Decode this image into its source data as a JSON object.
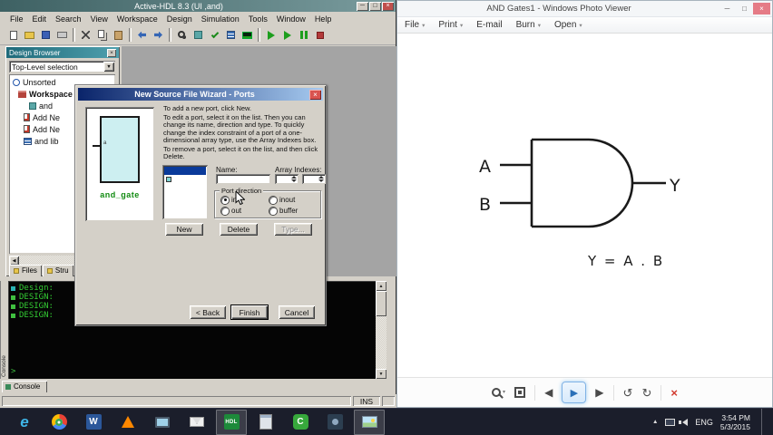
{
  "glyphs": {
    "minimize": "─",
    "maximize": "□",
    "close": "×",
    "up": "▲",
    "down": "▼",
    "left": "◀",
    "right": "▶",
    "play": "▶",
    "rotate_ccw": "↺",
    "rotate_cw": "↻",
    "delete_x": "×",
    "menu_arrow": "▾",
    "prompt": ">"
  },
  "hdl": {
    "title": "Active-HDL 8.3 (UI ,and)",
    "menus": [
      "File",
      "Edit",
      "Search",
      "View",
      "Workspace",
      "Design",
      "Simulation",
      "Tools",
      "Window",
      "Help"
    ],
    "toolbar_icons": [
      "new-file",
      "open",
      "save",
      "print",
      "cut",
      "copy",
      "paste",
      "undo",
      "redo",
      "find",
      "compile",
      "check",
      "library",
      "waveform",
      "run",
      "run-for",
      "pause",
      "stop"
    ],
    "browser": {
      "title": "Design Browser",
      "dropdown_value": "Top-Level selection",
      "tree": [
        "Unsorted",
        "Workspace",
        "and",
        "Add Ne",
        "Add Ne",
        "and lib"
      ],
      "tabs": [
        "Files",
        "Stru"
      ]
    },
    "console": {
      "side_label": "Console",
      "lines": [
        "Design:",
        "DESIGN:",
        "DESIGN:",
        "DESIGN:"
      ],
      "tab": "Console"
    },
    "status_ins": "INS"
  },
  "wizard": {
    "title": "New Source File Wizard - Ports",
    "intro": "To add a new port, click New.",
    "edit_help": "To edit a port, select it on the list. Then you can change its name, direction and type. To quickly change the index constraint of a port of a one-dimensional array type, use the Array Indexes box.",
    "remove_help": "To remove a port, select it on the list, and then click Delete.",
    "name_label": "Name:",
    "name_value": "",
    "array_label": "Array Indexes:",
    "group_label": "Port direction",
    "dir_in": "in",
    "dir_out": "out",
    "dir_inout": "inout",
    "dir_buffer": "buffer",
    "selected_direction": "in",
    "new_btn": "New",
    "delete_btn": "Delete",
    "type_btn": "Type...",
    "back_btn": "< Back",
    "finish_btn": "Finish",
    "cancel_btn": "Cancel",
    "symbol_label": "and_gate",
    "port_name": "a"
  },
  "viewer": {
    "title": "AND Gates1 - Windows Photo Viewer",
    "menus": [
      "File",
      "Print",
      "E-mail",
      "Burn",
      "Open"
    ],
    "gate": {
      "input_a": "A",
      "input_b": "B",
      "output": "Y",
      "formula": "Y = A . B"
    }
  },
  "taskbar": {
    "icons": [
      "internet-explorer",
      "chrome",
      "word",
      "media-player",
      "display",
      "mail",
      "active-hdl",
      "calculator",
      "c-app",
      "dark-app",
      "photo-viewer"
    ],
    "ie_letter": "e",
    "word_letter": "W",
    "hdl_letters": "HDL",
    "c_letter": "C",
    "tray": {
      "lang": "ENG",
      "time": "3:54 PM",
      "date": "5/3/2015"
    }
  }
}
